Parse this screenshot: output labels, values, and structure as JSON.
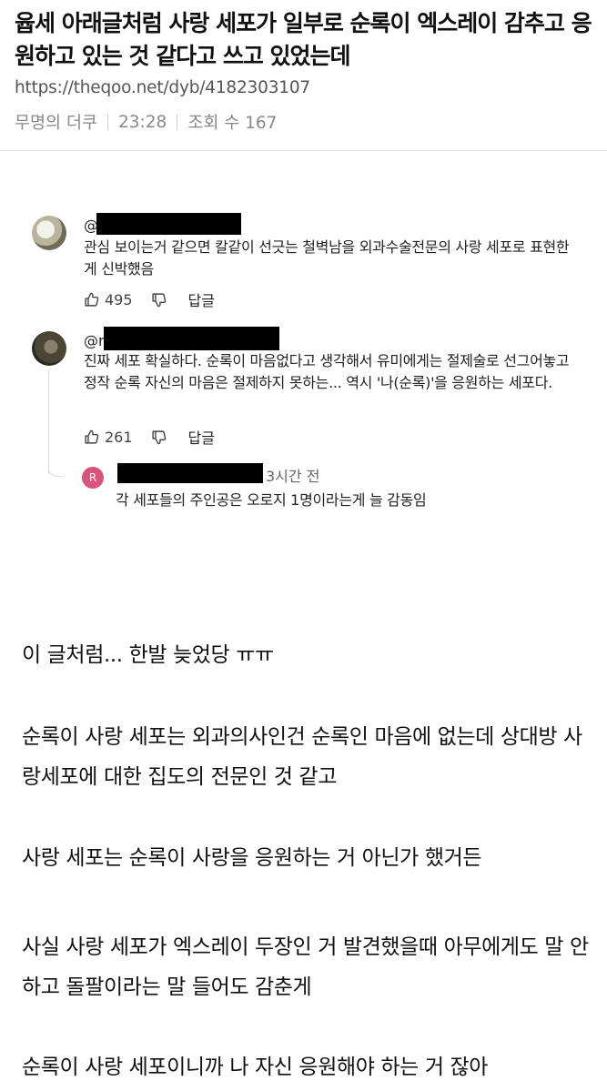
{
  "post": {
    "title": "윱세 아래글처럼 사랑 세포가 일부로 순록이 엑스레이 감추고 응원하고 있는 것 같다고 쓰고 있었는데",
    "url": "https://theqoo.net/dyb/4182303107",
    "author": "무명의 더쿠",
    "time": "23:28",
    "views": "조회 수 167"
  },
  "comments": [
    {
      "handle": "@",
      "text": "관심 보이는거 같으면 칼같이 선긋는 철벽남을 외과수술전문의 사랑 세포로 표현한게 신박했음",
      "likes": "495",
      "reply_label": "답글"
    },
    {
      "handle": "@r",
      "text": "진짜 세포 확실하다. 순록이 마음없다고 생각해서 유미에게는 절제술로 선그어놓고 정작 순록 자신의 마음은 절제하지 못하는... 역시 '나(순록)'을 응원하는 세포다.",
      "likes": "261",
      "reply_label": "답글",
      "reply": {
        "avatar_letter": "R",
        "time": "3시간 전",
        "text": "각 세포들의 주인공은 오로지 1명이라는게 늘 감동임"
      }
    }
  ],
  "body": [
    "이 글처럼... 한발 늦었당 ㅠㅠ",
    "순록이 사랑 세포는 외과의사인건 순록인 마음에 없는데 상대방 사랑세포에 대한 집도의 전문인 것 같고",
    "사랑 세포는 순록이 사랑을 응원하는 거 아닌가 했거든",
    "사실 사랑 세포가 엑스레이 두장인 거 발견했을때 아무에게도 말 안하고 돌팔이라는 말 들어도 감춘게",
    "순록이 사랑 세포이니까 나 자신 응원해야 하는 거 잖아"
  ]
}
